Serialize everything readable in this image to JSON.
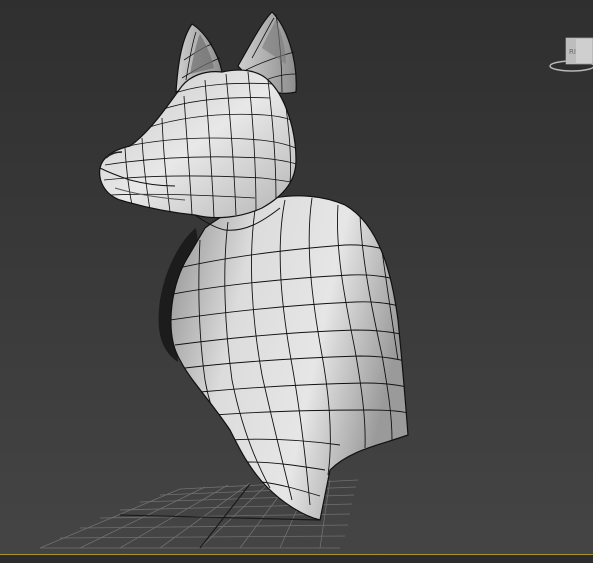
{
  "viewport": {
    "mode": "shaded-wireframe",
    "background": "#3a3a3a",
    "grid_color": "#707070",
    "frame_color": "#a9932f"
  },
  "model": {
    "name": "fox-bust",
    "shading": "#d2d2d2",
    "wire_color": "#111111"
  },
  "viewcube": {
    "icon": "viewcube-icon",
    "face_label": "RI"
  }
}
